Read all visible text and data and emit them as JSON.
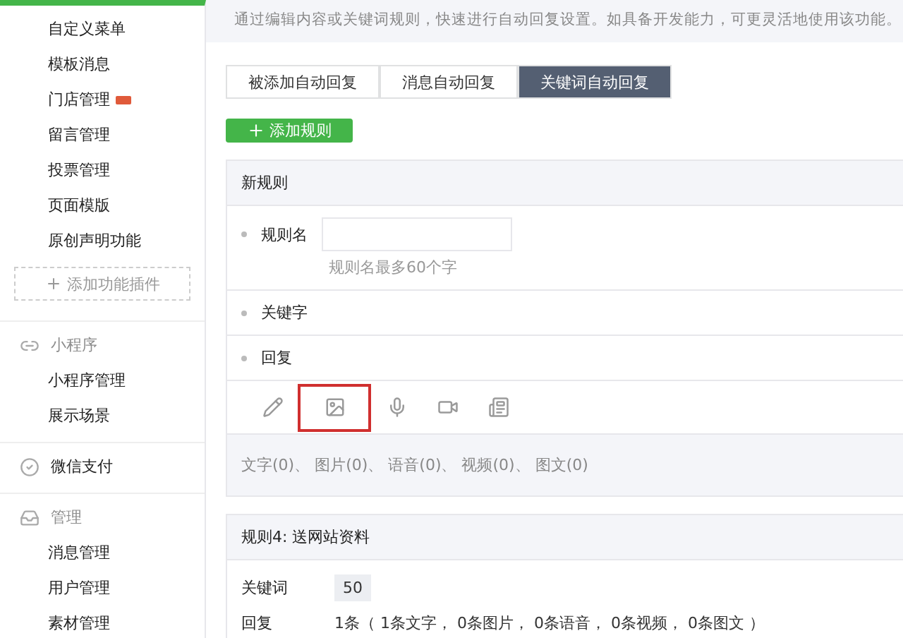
{
  "sidebar": {
    "sections": [
      {
        "items": [
          {
            "label": "自定义菜单",
            "badge": false
          },
          {
            "label": "模板消息",
            "badge": false
          },
          {
            "label": "门店管理",
            "badge": true
          },
          {
            "label": "留言管理",
            "badge": false
          },
          {
            "label": "投票管理",
            "badge": false
          },
          {
            "label": "页面模版",
            "badge": false
          },
          {
            "label": "原创声明功能",
            "badge": false
          }
        ],
        "add_plugin": "添加功能插件"
      },
      {
        "title": "小程序",
        "items": [
          {
            "label": "小程序管理",
            "badge": false
          },
          {
            "label": "展示场景",
            "badge": false
          }
        ]
      },
      {
        "title": "微信支付"
      },
      {
        "title": "管理",
        "items": [
          {
            "label": "消息管理",
            "badge": false
          },
          {
            "label": "用户管理",
            "badge": false
          },
          {
            "label": "素材管理",
            "badge": false
          }
        ]
      }
    ]
  },
  "notice": "通过编辑内容或关键词规则，快速进行自动回复设置。如具备开发能力，可更灵活地使用该功能。",
  "tabs": [
    {
      "label": "被添加自动回复",
      "selected": false
    },
    {
      "label": "消息自动回复",
      "selected": false
    },
    {
      "label": "关键词自动回复",
      "selected": true
    }
  ],
  "add_rule_button": "添加规则",
  "new_rule": {
    "title": "新规则",
    "name_label": "规则名",
    "name_hint": "规则名最多60个字",
    "keyword_label": "关键字",
    "reply_label": "回复",
    "tools": [
      {
        "kind": "text",
        "selected": false
      },
      {
        "kind": "image",
        "selected": true
      },
      {
        "kind": "voice",
        "selected": false
      },
      {
        "kind": "video",
        "selected": false
      },
      {
        "kind": "news",
        "selected": false
      }
    ],
    "counts": "文字(0)、 图片(0)、 语音(0)、 视频(0)、 图文(0)"
  },
  "rule": {
    "title": "规则4: 送网站资料",
    "keyword_label": "关键词",
    "keyword": "50",
    "reply_label": "回复",
    "reply": "1条（ 1条文字， 0条图片， 0条语音， 0条视频， 0条图文 ）"
  }
}
